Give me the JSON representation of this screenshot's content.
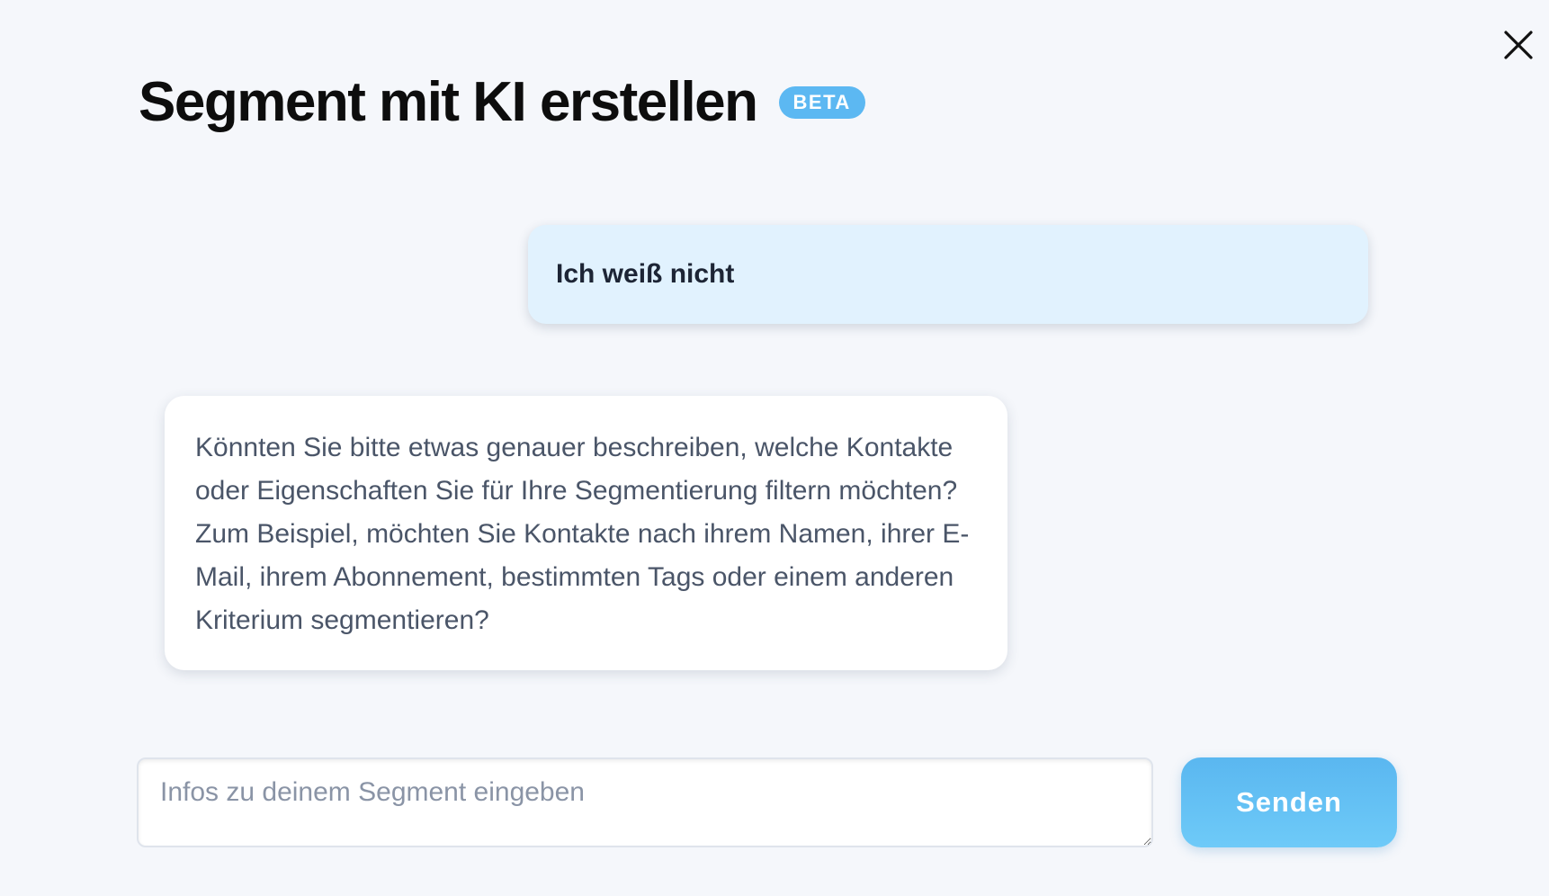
{
  "dialog": {
    "title": "Segment mit KI erstellen",
    "badge": "BETA",
    "close_icon": "close-icon"
  },
  "chat": {
    "messages": [
      {
        "role": "user",
        "text": "Ich weiß nicht"
      },
      {
        "role": "assistant",
        "text": "Könnten Sie bitte etwas genauer beschreiben, welche Kontakte oder Eigenschaften Sie für Ihre Segmentierung filtern möchten? Zum Beispiel, möchten Sie Kontakte nach ihrem Namen, ihrer E-Mail, ihrem Abonnement, bestimmten Tags oder einem anderen Kriterium segmentieren?"
      }
    ]
  },
  "composer": {
    "placeholder": "Infos zu deinem Segment eingeben",
    "value": "",
    "send_label": "Senden"
  },
  "colors": {
    "background": "#f5f7fb",
    "accent": "#5cb8f2",
    "user_bubble": "#e1f2fe",
    "assistant_bubble": "#ffffff"
  }
}
